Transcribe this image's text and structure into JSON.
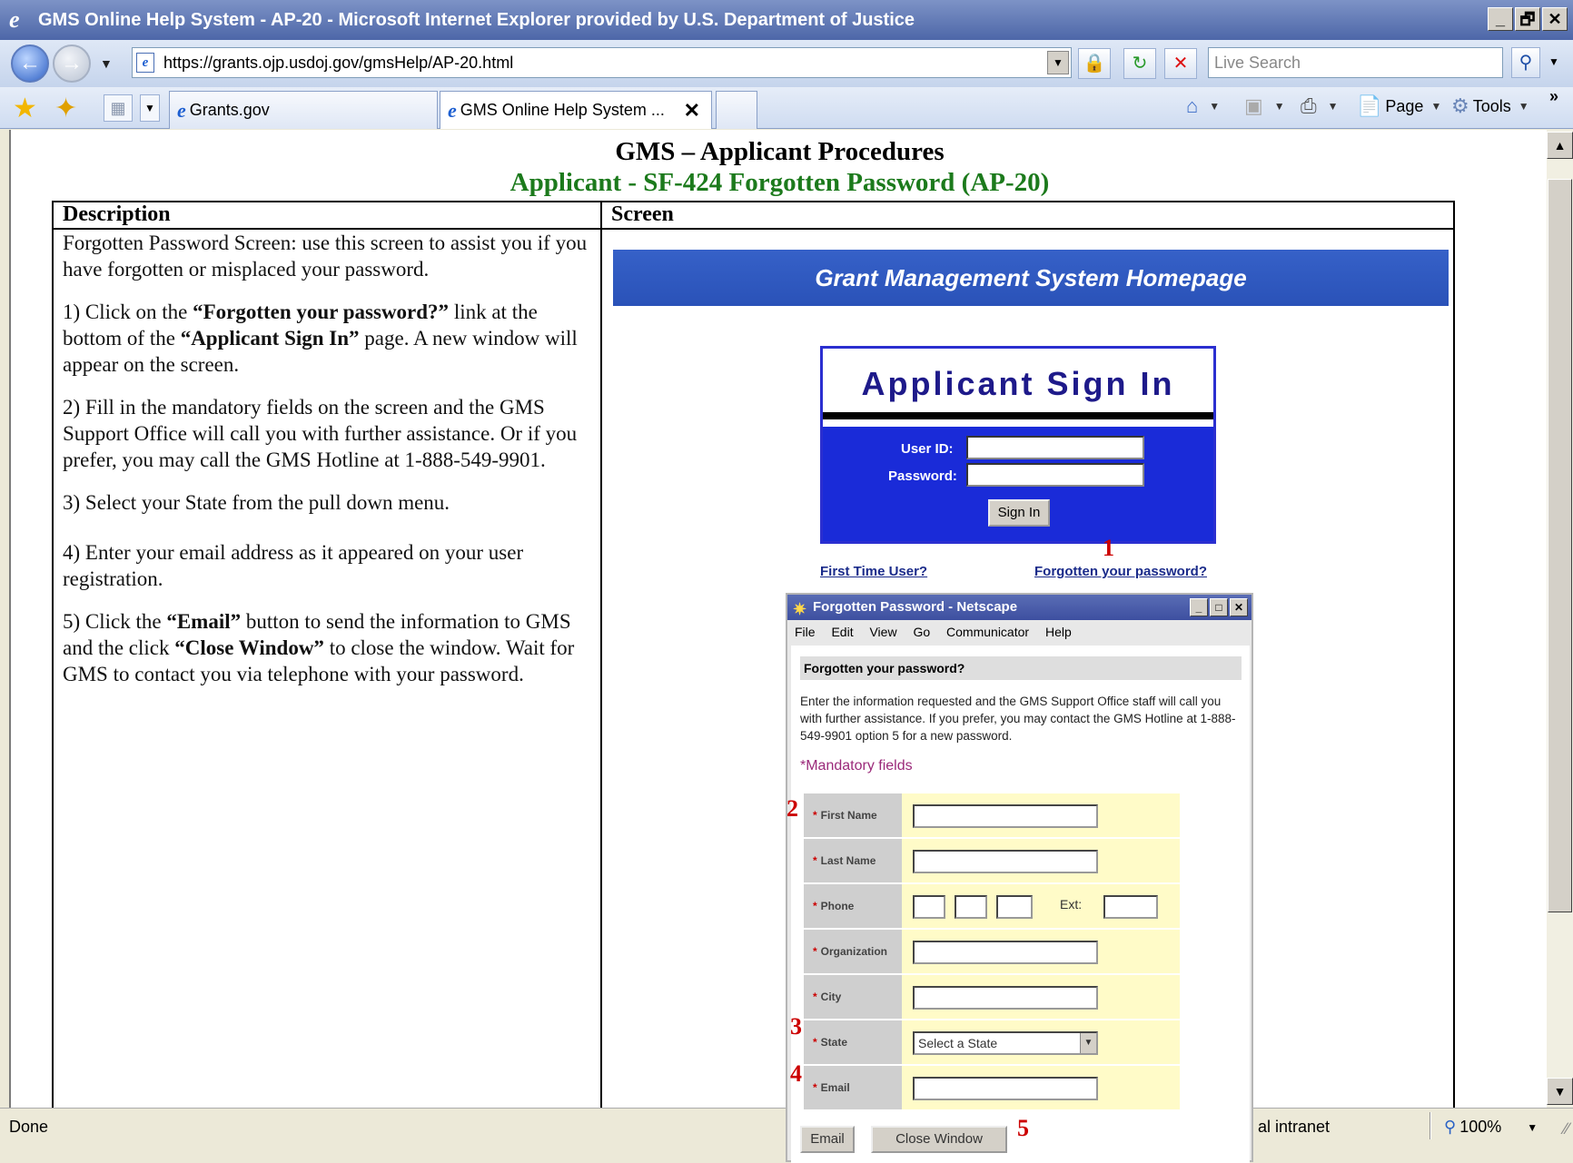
{
  "window": {
    "title": "GMS Online Help System - AP-20 - Microsoft Internet Explorer provided by U.S. Department of Justice",
    "minimize": "_",
    "restore": "🗗",
    "close": "✕"
  },
  "address_bar": {
    "url": "https://grants.ojp.usdoj.gov/gmsHelp/AP-20.html",
    "search_placeholder": "Live Search"
  },
  "tabs": [
    {
      "label": "Grants.gov",
      "active": false
    },
    {
      "label": "GMS Online Help System ...",
      "active": true
    }
  ],
  "command_bar": {
    "page": "Page",
    "tools": "Tools",
    "more": "»"
  },
  "document": {
    "title": "GMS – Applicant Procedures",
    "subtitle": "Applicant - SF-424 Forgotten Password (AP-20)",
    "col_description": "Description",
    "col_screen": "Screen",
    "intro": "Forgotten Password Screen: use this screen to assist you if you have forgotten or misplaced your password.",
    "step1_pre": "1) Click on the ",
    "step1_b1": "“Forgotten your password?”",
    "step1_mid": " link at the bottom of the ",
    "step1_b2": "“Applicant Sign In”",
    "step1_post": " page.  A new window will appear on the screen.",
    "step2": "2) Fill in the mandatory fields on the screen and the GMS Support Office will call you with further assistance.  Or if you prefer, you may call the GMS Hotline at 1-888-549-9901.",
    "step3": "3) Select your State from the pull down menu.",
    "step4": "4) Enter your email address as it appeared on your user registration.",
    "step5_pre": "5) Click the ",
    "step5_b1": "“Email”",
    "step5_mid": " button to send the information to GMS and the click ",
    "step5_b2": "“Close Window”",
    "step5_post": " to close the window.  Wait for GMS to contact you via telephone with your password."
  },
  "screen_mock": {
    "banner": "Grant Management System Homepage",
    "signin_title": "Applicant Sign In",
    "user_id_label": "User  ID:",
    "password_label": "Password:",
    "signin_button": "Sign In",
    "first_time_link": "First Time User?",
    "forgot_link": "Forgotten your password?",
    "num1": "1",
    "num2": "2",
    "num3": "3",
    "num4": "4",
    "num5": "5"
  },
  "popup": {
    "title": "Forgotten Password - Netscape",
    "menu": [
      "File",
      "Edit",
      "View",
      "Go",
      "Communicator",
      "Help"
    ],
    "heading": "Forgotten your password?",
    "instructions": "Enter the information requested and the GMS Support Office staff will call you with further assistance. If you prefer, you may contact the GMS Hotline at 1-888-549-9901 option 5 for a new password.",
    "mandatory": "*Mandatory fields",
    "fields": {
      "first_name": "First Name",
      "last_name": "Last Name",
      "phone": "Phone",
      "ext": "Ext:",
      "organization": "Organization",
      "city": "City",
      "state": "State",
      "email": "Email"
    },
    "state_select": "Select a State",
    "email_button": "Email",
    "close_button": "Close Window"
  },
  "status_bar": {
    "status": "Done",
    "zone": "al intranet",
    "zoom": "100%"
  }
}
